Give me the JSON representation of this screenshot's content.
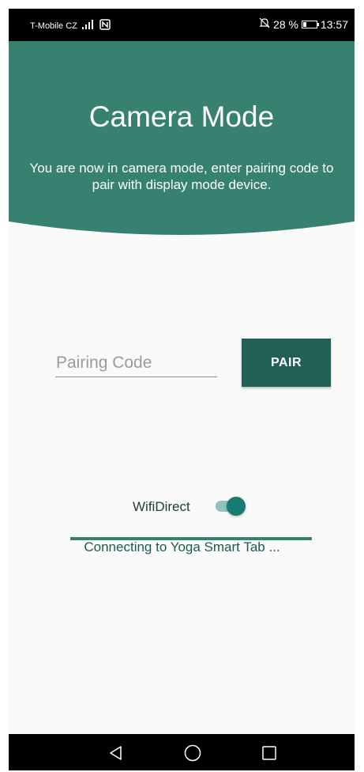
{
  "status_bar": {
    "carrier": "T-Mobile CZ",
    "battery_text": "28 %",
    "battery_level": 0.28,
    "time": "13:57",
    "icons": [
      "signal-icon",
      "nfc-icon",
      "mute-icon",
      "battery-icon"
    ]
  },
  "header": {
    "title": "Camera Mode",
    "subtitle": "You are now in camera mode, enter pairing code to pair with display mode device."
  },
  "pairing": {
    "input_value": "",
    "placeholder": "Pairing Code",
    "button_label": "PAIR"
  },
  "wifi": {
    "label": "WifiDirect",
    "enabled": true
  },
  "connection": {
    "status_text": "Connecting to Yoga Smart Tab ...",
    "progress": 1.0
  },
  "nav_bar": {
    "buttons": [
      "back-icon",
      "home-icon",
      "recents-icon"
    ]
  },
  "colors": {
    "header_bg": "#368170",
    "button_bg": "#225f57",
    "accent": "#177c6f",
    "background": "#fafafa"
  }
}
